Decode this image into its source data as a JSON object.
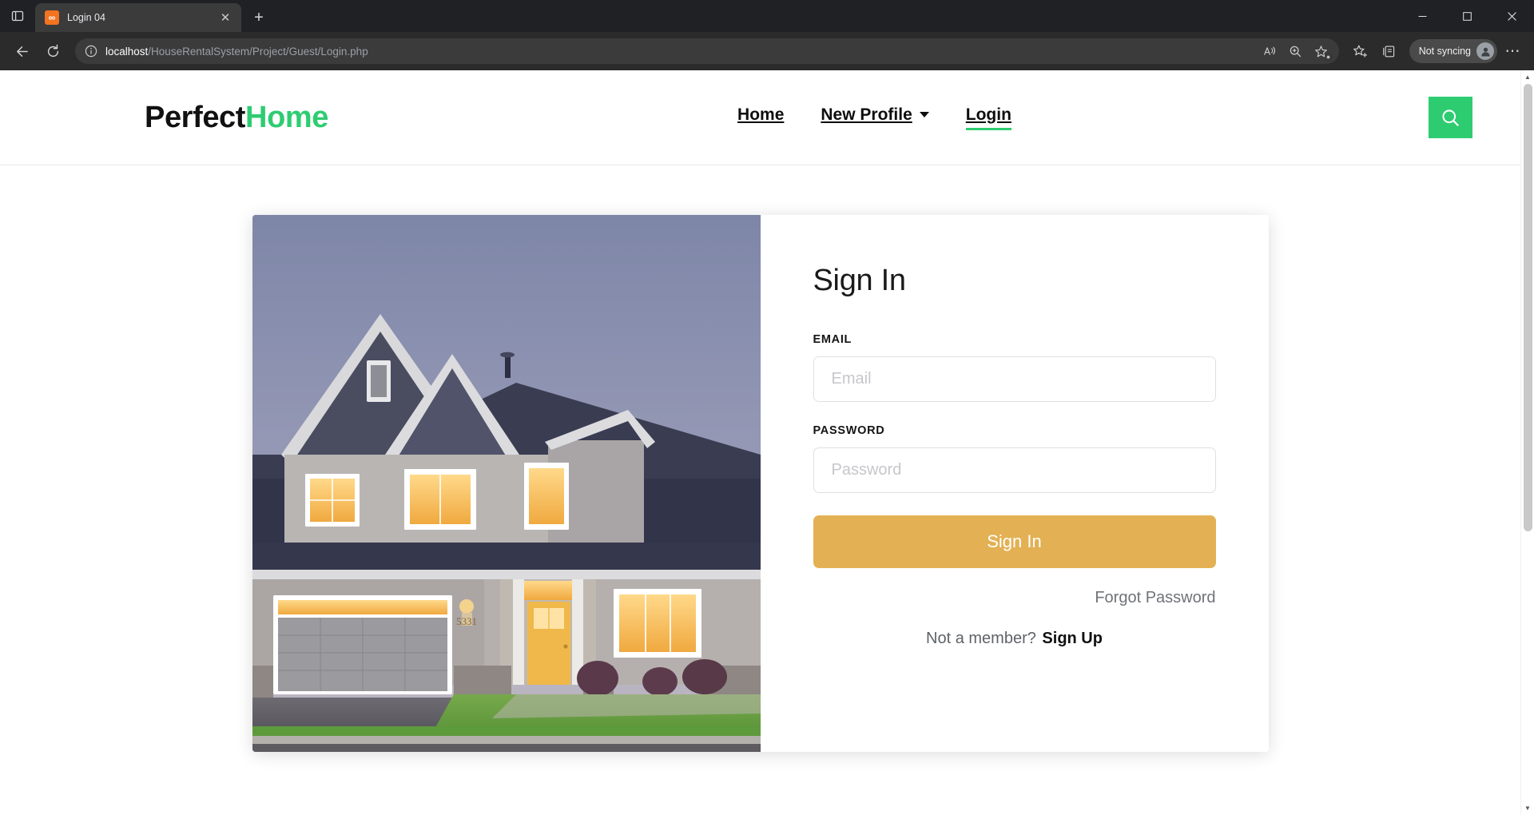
{
  "browser": {
    "tab": {
      "title": "Login 04",
      "favicon_name": "xampp-favicon",
      "favicon_glyph": "∞",
      "favicon_color": "#f37321",
      "close_glyph": "✕"
    },
    "new_tab_glyph": "+",
    "tab_search_name": "tab-search-icon",
    "window_controls": {
      "minimize": "─",
      "maximize": "☐",
      "close": "✕"
    },
    "toolbar": {
      "back_name": "back-arrow-icon",
      "refresh_name": "refresh-icon",
      "info_name": "site-information-icon",
      "url_host": "localhost",
      "url_path": "/HouseRentalSystem/Project/Guest/Login.php",
      "read_aloud_name": "read-aloud-icon",
      "zoom_name": "zoom-in-icon",
      "favorite_name": "add-favorite-icon",
      "favorites_name": "favorites-icon",
      "collections_name": "collections-icon",
      "profile_label": "Not syncing",
      "profile_avatar_name": "profile-avatar-icon",
      "settings_name": "settings-and-more-icon",
      "settings_glyph": "⋯"
    }
  },
  "site": {
    "logo": {
      "first": "Perfect",
      "second": "Home"
    },
    "nav": [
      {
        "label": "Home",
        "active": false,
        "has_caret": false
      },
      {
        "label": "New Profile",
        "active": false,
        "has_caret": true
      },
      {
        "label": "Login",
        "active": true,
        "has_caret": false
      }
    ],
    "search_button_name": "search-icon",
    "accent_color": "#2ecc71"
  },
  "login": {
    "title": "Sign In",
    "email_label": "EMAIL",
    "email_placeholder": "Email",
    "email_value": "",
    "password_label": "PASSWORD",
    "password_placeholder": "Password",
    "password_value": "",
    "submit_label": "Sign In",
    "submit_color": "#e3b154",
    "forgot_label": "Forgot Password",
    "member_prompt": "Not a member?",
    "signup_label": "Sign Up",
    "image_alt": "two-story-suburban-house-at-dusk"
  },
  "scrollbar": {
    "up_glyph": "▲",
    "down_glyph": "▼"
  }
}
